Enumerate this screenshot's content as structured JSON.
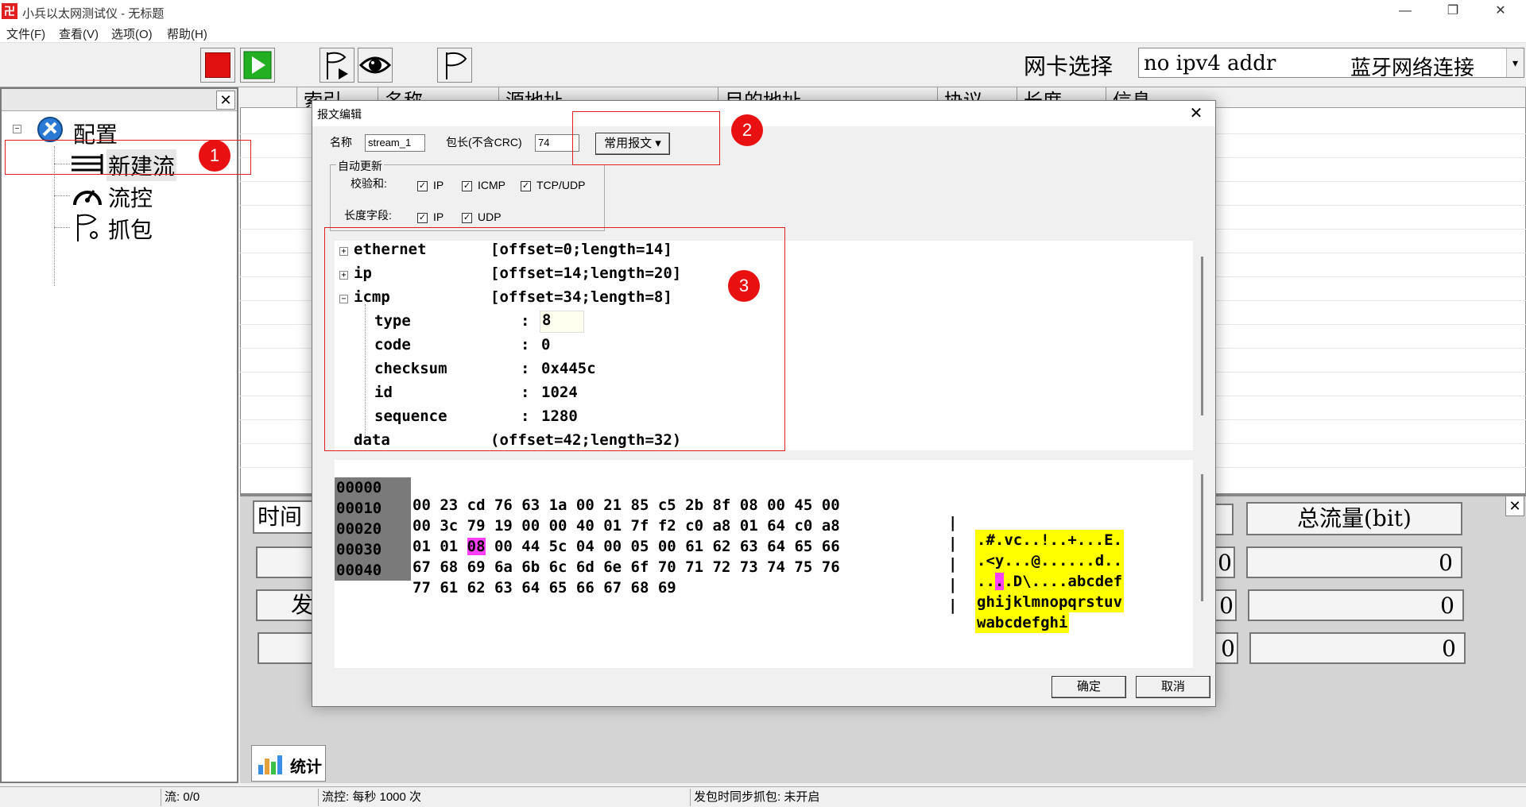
{
  "window": {
    "title": "小兵以太网测试仪 - 无标题",
    "app_icon_glyph": "卍",
    "controls": {
      "minimize": "—",
      "maximize": "❐",
      "close": "✕"
    }
  },
  "menu": [
    "文件(F)",
    "查看(V)",
    "选项(O)",
    "帮助(H)"
  ],
  "toolbar": {
    "nic_label": "网卡选择",
    "nic_value": "no ipv4 addr",
    "nic_desc": "蓝牙网络连接",
    "dropdown_glyph": "▾"
  },
  "left_panel": {
    "close": "✕",
    "root": "配置",
    "items": [
      "新建流",
      "流控",
      "抓包"
    ]
  },
  "list_columns": [
    "索引",
    "名称",
    "源地址",
    "目的地址",
    "协议",
    "长度",
    "信息"
  ],
  "stats": {
    "time_label": "时间",
    "total_label": "总流量(bit)",
    "left_values": [
      "0",
      "0",
      "0"
    ],
    "total_values": [
      "0",
      "0",
      "0"
    ],
    "partial_char": "发",
    "tab_label": "统计",
    "close": "✕"
  },
  "status": [
    "流: 0/0",
    "流控: 每秒 1000 次",
    "发包时同步抓包: 未开启"
  ],
  "dialog": {
    "title": "报文编辑",
    "close": "✕",
    "name_label": "名称",
    "name_value": "stream_1",
    "len_label": "包长(不含CRC)",
    "len_value": "74",
    "common_button": "常用报文 ▾",
    "auto_update_label": "自动更新",
    "checksum_label": "校验和:",
    "length_field_label": "长度字段:",
    "checksum_opts": [
      "IP",
      "ICMP",
      "TCP/UDP"
    ],
    "length_opts": [
      "IP",
      "UDP"
    ],
    "check_glyph": "✓",
    "ok": "确定",
    "cancel": "取消",
    "tree": {
      "ethernet": {
        "name": "ethernet",
        "info": "[offset=0;length=14]"
      },
      "ip": {
        "name": "ip",
        "info": "[offset=14;length=20]"
      },
      "icmp": {
        "name": "icmp",
        "info": "[offset=34;length=8]"
      },
      "fields": [
        {
          "name": "type",
          "value": "8"
        },
        {
          "name": "code",
          "value": "0"
        },
        {
          "name": "checksum",
          "value": "0x445c"
        },
        {
          "name": "id",
          "value": "1024"
        },
        {
          "name": "sequence",
          "value": "1280"
        }
      ],
      "data": {
        "name": "data",
        "info": "(offset=42;length=32)"
      },
      "expand_glyph": "+",
      "collapse_glyph": "−",
      "colon": ":"
    },
    "hex": [
      {
        "offset": "00000",
        "bytes": "00 23 cd 76 63 1a 00 21 85 c5 2b 8f 08 00 45 00",
        "ascii": ".#.vc..!..+...E."
      },
      {
        "offset": "00010",
        "bytes": "00 3c 79 19 00 00 40 01 7f f2 c0 a8 01 64 c0 a8",
        "ascii": ".<y...@......d.."
      },
      {
        "offset": "00020",
        "bytes_pre": "01 01 ",
        "bytes_hl": "08",
        "bytes_post": " 00 44 5c 04 00 05 00 61 62 63 64 65 66",
        "ascii_pre": "..",
        "ascii_hl": ".",
        "ascii_post": ".D\\....abcdef"
      },
      {
        "offset": "00030",
        "bytes": "67 68 69 6a 6b 6c 6d 6e 6f 70 71 72 73 74 75 76",
        "ascii": "ghijklmnopqrstuv"
      },
      {
        "offset": "00040",
        "bytes": "77 61 62 63 64 65 66 67 68 69",
        "ascii": "wabcdefghi"
      }
    ],
    "hex_separator": "|"
  },
  "annotations": [
    "1",
    "2",
    "3"
  ],
  "colors": {
    "annotation": "#e81010",
    "ascii_bg": "#ffff00",
    "highlight": "#ff40ff"
  }
}
